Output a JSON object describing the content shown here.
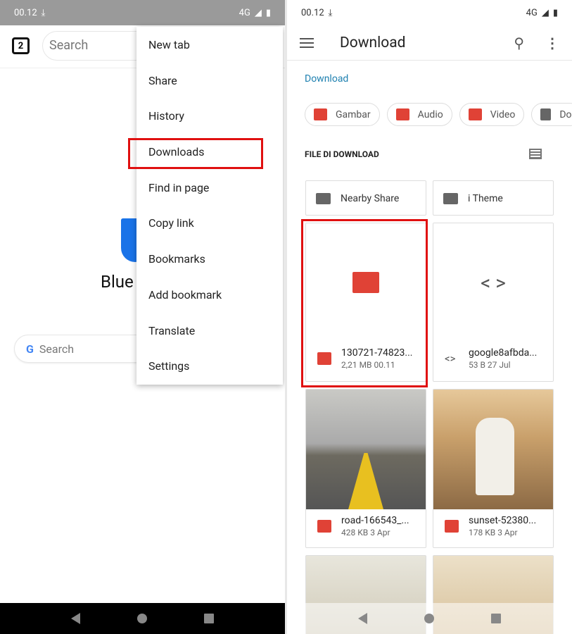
{
  "left": {
    "status": {
      "time": "00.12",
      "network": "4G"
    },
    "tab_count": "2",
    "omnibox_placeholder": "Search",
    "brand_text": "Blue",
    "google_search_placeholder": "Search",
    "menu": [
      {
        "label": "New tab"
      },
      {
        "label": "Share"
      },
      {
        "label": "History"
      },
      {
        "label": "Downloads"
      },
      {
        "label": "Find in page"
      },
      {
        "label": "Copy link"
      },
      {
        "label": "Bookmarks"
      },
      {
        "label": "Add bookmark"
      },
      {
        "label": "Translate"
      },
      {
        "label": "Settings"
      }
    ],
    "highlighted_item": "Downloads"
  },
  "right": {
    "status": {
      "time": "00.12",
      "network": "4G"
    },
    "title": "Download",
    "breadcrumb": "Download",
    "chips": [
      {
        "label": "Gambar",
        "icon": "image-icon"
      },
      {
        "label": "Audio",
        "icon": "headphones-icon"
      },
      {
        "label": "Video",
        "icon": "movie-icon"
      },
      {
        "label": "Do",
        "icon": "document-icon"
      }
    ],
    "section_title": "FILE DI DOWNLOAD",
    "folders": [
      {
        "name": "Nearby Share"
      },
      {
        "name": "i Theme"
      }
    ],
    "files": [
      {
        "name": "130721-74823...",
        "meta": "2,21 MB 00.11",
        "icon": "movie-icon",
        "highlighted": true
      },
      {
        "name": "google8afbda...",
        "meta": "53 B 27 Jul",
        "icon": "code-icon"
      },
      {
        "name": "road-166543_...",
        "meta": "428 KB 3 Apr",
        "icon": "image-icon"
      },
      {
        "name": "sunset-52380...",
        "meta": "178 KB 3 Apr",
        "icon": "image-icon"
      }
    ]
  },
  "colors": {
    "highlight": "#e01010",
    "accent_red": "#e04236",
    "link": "#1e80b0"
  }
}
